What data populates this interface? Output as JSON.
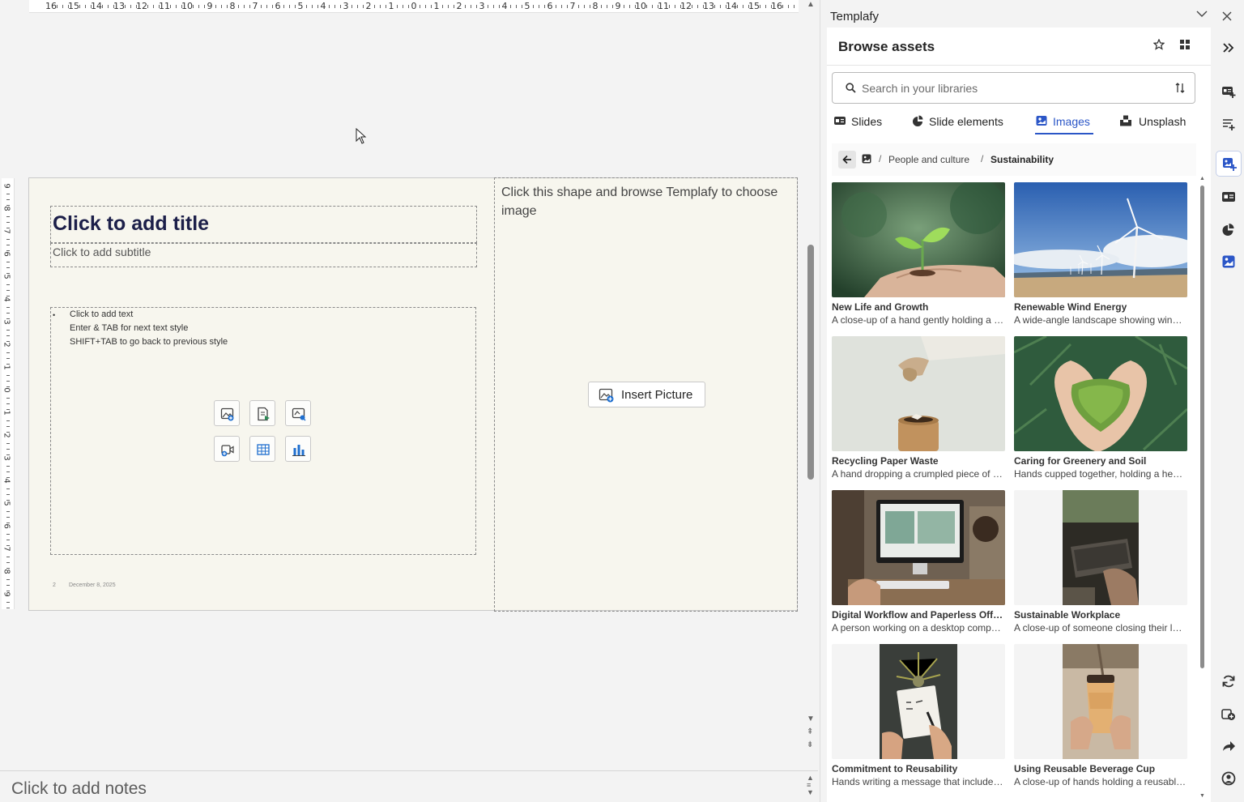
{
  "ruler": {
    "horizontal_labels": [
      "16",
      "15",
      "14",
      "13",
      "12",
      "11",
      "10",
      "9",
      "8",
      "7",
      "6",
      "5",
      "4",
      "3",
      "2",
      "1",
      "0",
      "1",
      "2",
      "3",
      "4",
      "5",
      "6",
      "7",
      "8",
      "9",
      "10",
      "11",
      "12",
      "13",
      "14",
      "15",
      "16"
    ],
    "vertical_labels": [
      "9",
      "8",
      "7",
      "6",
      "5",
      "4",
      "3",
      "2",
      "1",
      "0",
      "1",
      "2",
      "3",
      "4",
      "5",
      "6",
      "7",
      "8",
      "9"
    ]
  },
  "slide": {
    "title_placeholder": "Click to add title",
    "subtitle_placeholder": "Click to add subtitle",
    "content_lines": [
      "Click to add text",
      "Enter & TAB for next text style",
      "SHIFT+TAB to go back to previous style"
    ],
    "content_bullet": "•",
    "insert_icons": [
      "insert-picture-icon",
      "insert-icon-file-icon",
      "insert-stock-image-icon",
      "insert-video-icon",
      "insert-table-icon",
      "insert-chart-icon"
    ],
    "footer_page": "2",
    "footer_date": "December 8, 2025",
    "picture_hint": "Click this shape and browse Templafy to choose image",
    "insert_picture_label": "Insert Picture"
  },
  "notes": {
    "placeholder": "Click to add notes"
  },
  "pane": {
    "title": "Templafy",
    "browse_title": "Browse assets",
    "search_placeholder": "Search in your libraries",
    "tabs": [
      {
        "label": "Slides",
        "icon": "slides-icon"
      },
      {
        "label": "Slide elements",
        "icon": "slide-elements-icon"
      },
      {
        "label": "Images",
        "icon": "images-icon",
        "active": true
      },
      {
        "label": "Unsplash",
        "icon": "unsplash-icon"
      }
    ],
    "breadcrumb": [
      "People and culture",
      "Sustainability"
    ],
    "breadcrumb_separator": "/",
    "assets": [
      {
        "title": "New Life and Growth",
        "description": "A close-up of a hand gently holding a small green sprout"
      },
      {
        "title": "Renewable Wind Energy",
        "description": "A wide-angle landscape showing wind turbines"
      },
      {
        "title": "Recycling Paper Waste",
        "description": "A hand dropping a crumpled piece of paper"
      },
      {
        "title": "Caring for Greenery and Soil",
        "description": "Hands cupped together, holding a heart of moss"
      },
      {
        "title": "Digital Workflow and Paperless Office",
        "description": "A person working on a desktop computer"
      },
      {
        "title": "Sustainable Workplace",
        "description": "A close-up of someone closing their laptop"
      },
      {
        "title": "Commitment to Reusability",
        "description": "Hands writing a message that includes reuse"
      },
      {
        "title": "Using Reusable Beverage Cup",
        "description": "A close-up of hands holding a reusable cup"
      }
    ],
    "rail_icons": [
      "expand-pane-icon",
      "add-slide-icon",
      "text-elements-icon",
      "image-library-icon",
      "slides-icon",
      "pie-chart-icon",
      "picture-icon",
      "refresh-icon",
      "add-copy-icon",
      "share-icon",
      "account-icon"
    ],
    "accent_color": "#2b56c7"
  }
}
